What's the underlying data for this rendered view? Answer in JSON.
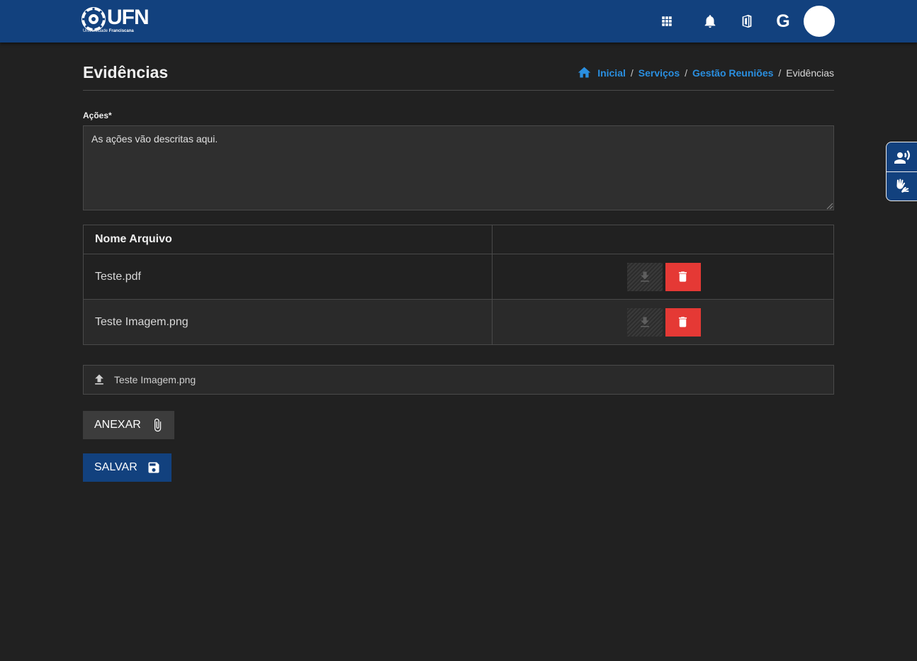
{
  "header": {
    "logo_text": "UFN",
    "logo_subtitle_1": "Universidade",
    "logo_subtitle_2": "Franciscana",
    "icons": [
      "apps-grid-icon",
      "bell-icon",
      "office-icon",
      "google-icon"
    ],
    "google_letter": "G"
  },
  "page": {
    "title": "Evidências"
  },
  "breadcrumb": {
    "items": [
      "Inicial",
      "Serviços",
      "Gestão Reuniões"
    ],
    "current": "Evidências",
    "separator": "/"
  },
  "form": {
    "acoes_label": "Ações*",
    "acoes_value": "As ações vão descritas aqui."
  },
  "files_table": {
    "columns": [
      "Nome Arquivo",
      ""
    ],
    "rows": [
      {
        "name": "Teste.pdf"
      },
      {
        "name": "Teste Imagem.png"
      }
    ]
  },
  "upload": {
    "filename": "Teste Imagem.png"
  },
  "buttons": {
    "anexar": "ANEXAR",
    "salvar": "SALVAR"
  },
  "colors": {
    "brand_blue": "#12417e",
    "link_blue": "#2a8fe0",
    "danger_red": "#e53935",
    "background": "#212121"
  }
}
